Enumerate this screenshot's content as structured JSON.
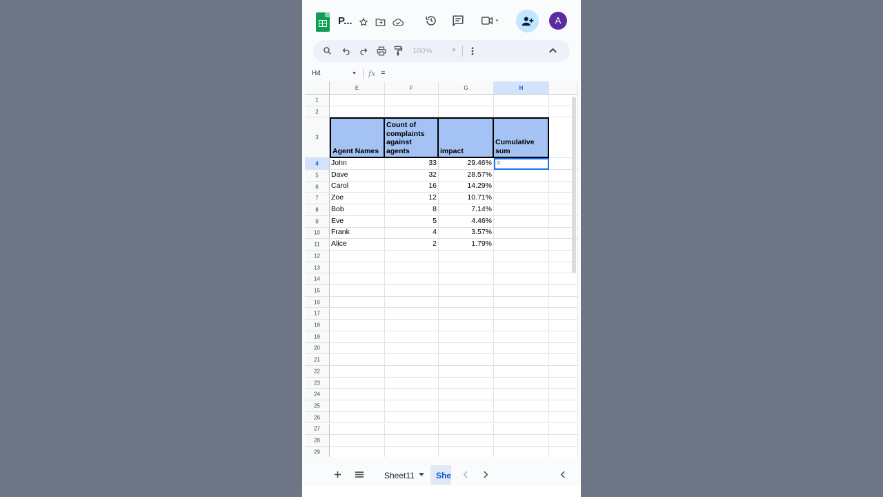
{
  "app": {
    "title": "P...",
    "avatar_initial": "A",
    "share_icon": "person-add-icon"
  },
  "toolbar": {
    "zoom": "100%"
  },
  "formula_bar": {
    "name_box": "H4",
    "fx_label": "fx",
    "value": "="
  },
  "columns": [
    "E",
    "F",
    "G",
    "H"
  ],
  "selected_column": "H",
  "rows": [
    "1",
    "2",
    "3",
    "4",
    "5",
    "6",
    "7",
    "8",
    "9",
    "10",
    "11",
    "12",
    "13",
    "14",
    "15",
    "16",
    "17",
    "18",
    "19",
    "20",
    "21",
    "22",
    "23",
    "24",
    "25",
    "26",
    "27",
    "28",
    "29"
  ],
  "selected_row": "4",
  "table": {
    "headers": {
      "agent": "Agent Names",
      "count_line1": "Count of",
      "count_line2": "complaints",
      "count_line3": "against",
      "count_line4": "agents",
      "impact": "impact",
      "cum_line1": "Cumulative",
      "cum_line2": "sum"
    },
    "data": [
      {
        "name": "John",
        "count": "33",
        "impact": "29.46%"
      },
      {
        "name": "Dave",
        "count": "32",
        "impact": "28.57%"
      },
      {
        "name": "Carol",
        "count": "16",
        "impact": "14.29%"
      },
      {
        "name": "Zoe",
        "count": "12",
        "impact": "10.71%"
      },
      {
        "name": "Bob",
        "count": "8",
        "impact": "7.14%"
      },
      {
        "name": "Eve",
        "count": "5",
        "impact": "4.46%"
      },
      {
        "name": "Frank",
        "count": "4",
        "impact": "3.57%"
      },
      {
        "name": "Alice",
        "count": "2",
        "impact": "1.79%"
      }
    ],
    "active_cell_value": "="
  },
  "sheets": {
    "sheet1": "Sheet11",
    "sheet2": "She"
  }
}
